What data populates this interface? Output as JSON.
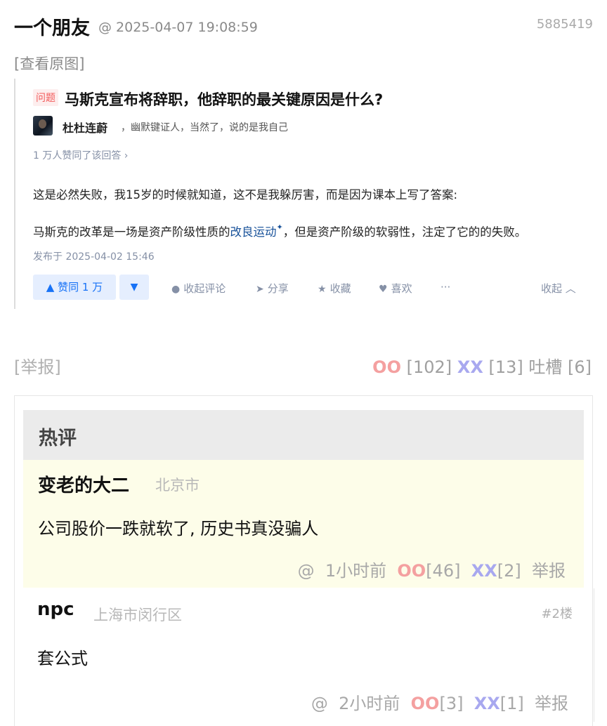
{
  "post": {
    "author": "一个朋友",
    "meta": "@ 2025-04-07 19:08:59",
    "id": "5885419",
    "view_original": "[查看原图]"
  },
  "screenshot": {
    "question_badge": "问题",
    "question_title": "马斯克宣布将辞职，他辞职的最关键原因是什么?",
    "answerer_name": "杜杜连蔚",
    "answerer_bio": "，幽默键证人，当然了，说的是我自己",
    "agree_count": "1 万人赞同了该回答 ›",
    "paragraph1": "这是必然失败，我15岁的时候就知道，这不是我躲厉害，而是因为课本上写了答案:",
    "paragraph2_a": "马斯克的改革是一场是资产阶级性质的",
    "paragraph2_link": "改良运动",
    "paragraph2_link_mark": "✦",
    "paragraph2_b": "，但是资产阶级的软弱性，注定了它的的失败。",
    "published": "发布于 2025-04-02 15:46",
    "upvote_label": "▲ 赞同 1 万",
    "downvote_label": "▼",
    "actions": {
      "collapse_comments": "收起评论",
      "share": "分享",
      "favorite": "收藏",
      "like": "喜欢",
      "more": "···",
      "collapse": "收起 ︿"
    },
    "icons": {
      "comment": "comment-bubble-icon",
      "share": "paper-plane-icon",
      "favorite": "star-icon",
      "like": "heart-icon"
    }
  },
  "post_footer": {
    "report": "[举报]",
    "oo_label": "OO",
    "oo_count": "[102]",
    "xx_label": "XX",
    "xx_count": "[13]",
    "tucao": "吐槽 [6]"
  },
  "hot_comments": {
    "header": "热评",
    "items": [
      {
        "name": "变老的大二",
        "location": "北京市",
        "text": "公司股价一跌就软了, 历史书真没骗人",
        "at": "@",
        "time": "1小时前",
        "oo_label": "OO",
        "oo_count": "[46]",
        "xx_label": "XX",
        "xx_count": "[2]",
        "report": "举报"
      }
    ]
  },
  "comments": [
    {
      "name": "npc",
      "location": "上海市闵行区",
      "floor": "#2楼",
      "text": "套公式",
      "at": "@",
      "time": "2小时前",
      "oo_label": "OO",
      "oo_count": "[3]",
      "xx_label": "XX",
      "xx_count": "[1]",
      "report": "举报"
    }
  ],
  "colors": {
    "oo": "#f4a0a0",
    "xx": "#a8a8ef",
    "hot_bg": "#fdfde9",
    "zhihu_blue": "#1772f6"
  }
}
